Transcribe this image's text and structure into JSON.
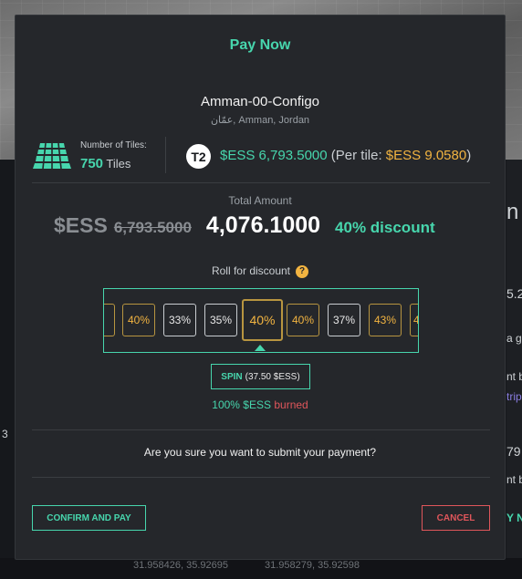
{
  "background": {
    "right_fragments": [
      "n",
      "5.2",
      "a g",
      "nt b",
      "trip",
      "79",
      "nt b",
      "Y N"
    ],
    "left_fragment": "3",
    "bottom_coords": [
      "31.958426, 35.92695",
      "31.958279, 35.92598"
    ]
  },
  "modal": {
    "title": "Pay Now",
    "place": {
      "name": "Amman-00-Configo",
      "subtitle": "عمّان, Amman, Jordan"
    },
    "tiles": {
      "label": "Number of Tiles:",
      "count": "750",
      "unit": "Tiles",
      "icon": "tiles-grid-icon"
    },
    "tier_badge": "T2",
    "price": {
      "amount": "$ESS 6,793.5000",
      "per_tile_prefix": "(Per tile: ",
      "per_tile_value": "$ESS 9.0580",
      "per_tile_suffix": ")"
    },
    "total": {
      "label": "Total Amount",
      "currency": "$ESS",
      "original": "6,793.5000",
      "discounted": "4,076.1000",
      "discount_text": "40% discount"
    },
    "roll": {
      "label": "Roll for discount",
      "help_icon": "?",
      "items": [
        "%",
        "40%",
        "33%",
        "35%",
        "40%",
        "40%",
        "37%",
        "43%",
        "4"
      ],
      "selected_index": 4
    },
    "spin_button": {
      "label": "SPIN",
      "cost": "(37.50 $ESS)"
    },
    "burn": {
      "percent": "100% $ESS",
      "word": "burned"
    },
    "confirm_question": "Are you sure you want to submit your payment?",
    "confirm_button": "CONFIRM AND PAY",
    "cancel_button": "CANCEL"
  },
  "colors": {
    "accent": "#47d6ad",
    "gold": "#f2b441",
    "danger": "#e0565b",
    "modal_bg": "#25272b"
  }
}
